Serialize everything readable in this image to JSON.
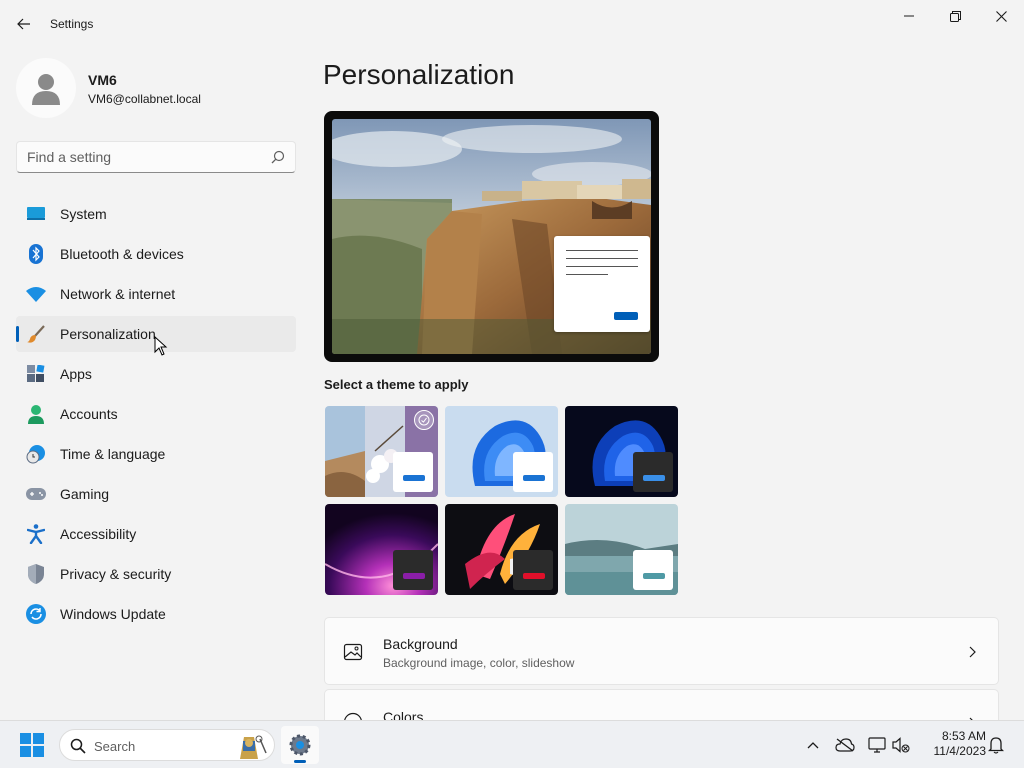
{
  "window": {
    "title": "Settings",
    "controls": {
      "minimize": "minimize-icon",
      "maximize": "restore-icon",
      "close": "close-icon"
    }
  },
  "user": {
    "name": "VM6",
    "email": "VM6@collabnet.local"
  },
  "search": {
    "placeholder": "Find a setting",
    "icon": "search-icon"
  },
  "sidebar": {
    "items": [
      {
        "label": "System",
        "icon": "system-icon",
        "active": false
      },
      {
        "label": "Bluetooth & devices",
        "icon": "bluetooth-icon",
        "active": false
      },
      {
        "label": "Network & internet",
        "icon": "wifi-icon",
        "active": false
      },
      {
        "label": "Personalization",
        "icon": "paintbrush-icon",
        "active": true
      },
      {
        "label": "Apps",
        "icon": "apps-icon",
        "active": false
      },
      {
        "label": "Accounts",
        "icon": "accounts-icon",
        "active": false
      },
      {
        "label": "Time & language",
        "icon": "time-language-icon",
        "active": false
      },
      {
        "label": "Gaming",
        "icon": "gamepad-icon",
        "active": false
      },
      {
        "label": "Accessibility",
        "icon": "accessibility-icon",
        "active": false
      },
      {
        "label": "Privacy & security",
        "icon": "shield-icon",
        "active": false
      },
      {
        "label": "Windows Update",
        "icon": "windows-update-icon",
        "active": false
      }
    ]
  },
  "main": {
    "title": "Personalization",
    "theme_caption": "Select a theme to apply",
    "themes": [
      {
        "name": "current-custom-theme",
        "selected": true
      },
      {
        "name": "windows-light-theme",
        "selected": false
      },
      {
        "name": "windows-dark-theme",
        "selected": false
      },
      {
        "name": "glow-theme",
        "selected": false
      },
      {
        "name": "captured-motion-theme",
        "selected": false
      },
      {
        "name": "flow-theme",
        "selected": false
      }
    ],
    "cards": [
      {
        "title": "Background",
        "subtitle": "Background image, color, slideshow",
        "icon": "image-icon"
      },
      {
        "title": "Colors",
        "subtitle": "",
        "icon": "palette-icon"
      }
    ]
  },
  "taskbar": {
    "search_label": "Search",
    "clock_time": "8:53 AM",
    "clock_date": "11/4/2023"
  },
  "colors": {
    "accent": "#005fb8",
    "background": "#f3f3f3",
    "card": "#fbfbfb"
  }
}
